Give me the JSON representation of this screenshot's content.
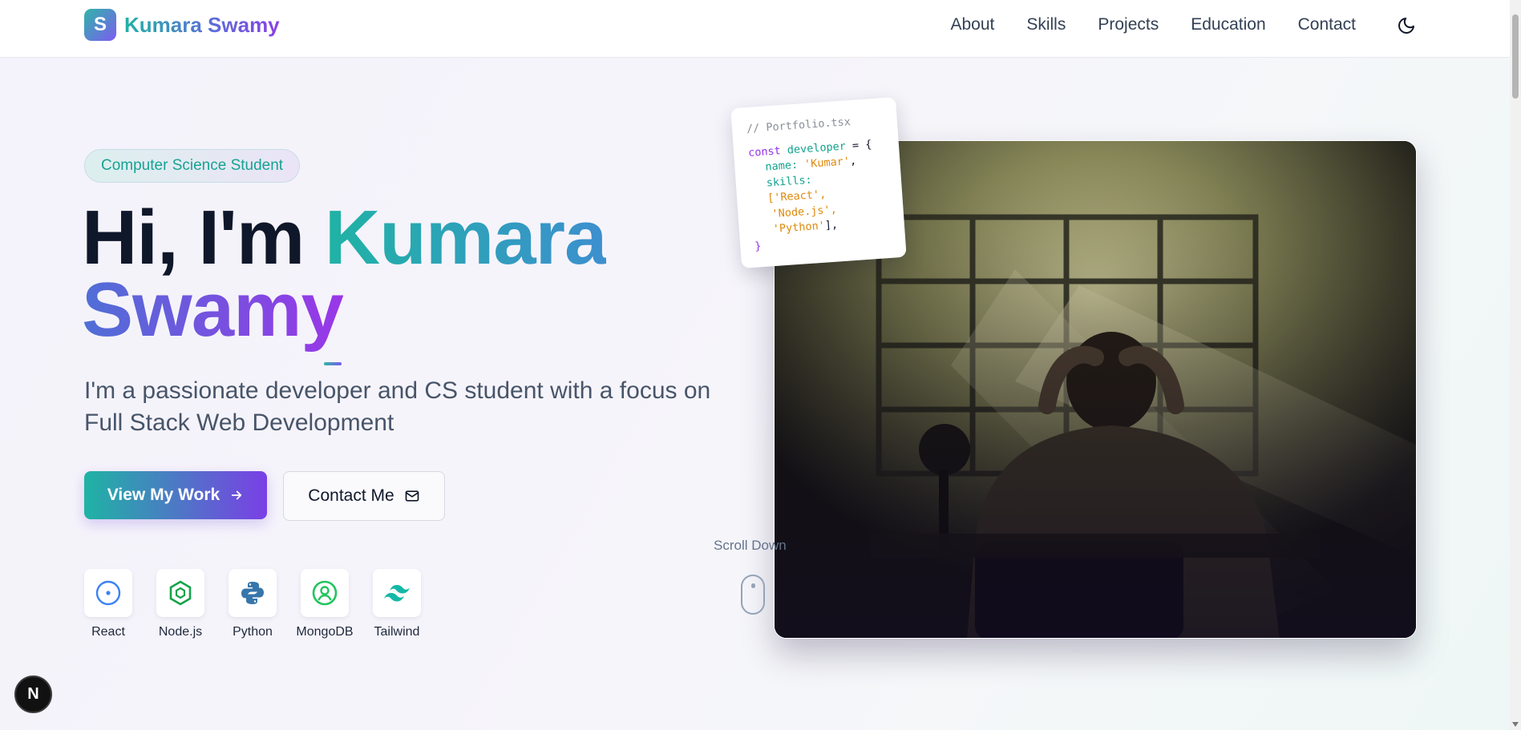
{
  "header": {
    "logo_letter": "S",
    "brand_name": "Kumara Swamy",
    "nav": [
      "About",
      "Skills",
      "Projects",
      "Education",
      "Contact"
    ],
    "theme_icon": "moon-icon"
  },
  "hero": {
    "badge": "Computer Science Student",
    "headline_prefix": "Hi, I'm ",
    "headline_name_1": "Kumara",
    "headline_name_2": "Swamy",
    "subtitle": "I'm a passionate developer and CS student with a focus on Full Stack Web Development",
    "primary_button": "View My Work",
    "secondary_button": "Contact Me",
    "tech": [
      {
        "label": "React",
        "icon": "react-icon",
        "color": "#3b82f6"
      },
      {
        "label": "Node.js",
        "icon": "nodejs-icon",
        "color": "#16a34a"
      },
      {
        "label": "Python",
        "icon": "python-icon",
        "color": "#3776ab"
      },
      {
        "label": "MongoDB",
        "icon": "mongodb-icon",
        "color": "#22c55e"
      },
      {
        "label": "Tailwind",
        "icon": "tailwind-icon",
        "color": "#14b8a6"
      }
    ]
  },
  "code_card": {
    "filename": "// Portfolio.tsx",
    "keyword": "const",
    "var_name": "developer",
    "assign": " = {",
    "name_key": "name: ",
    "name_value": "'Kumar'",
    "skills_key": "skills:",
    "skill_1": "['React',",
    "skill_2": "'Node.js',",
    "skill_3": "'Python'",
    "skill_3_close": "],",
    "close": "}"
  },
  "scroll_hint": "Scroll Down",
  "next_badge": "N",
  "colors": {
    "accent_teal": "#1fb3a4",
    "accent_purple": "#8b3fe6"
  }
}
